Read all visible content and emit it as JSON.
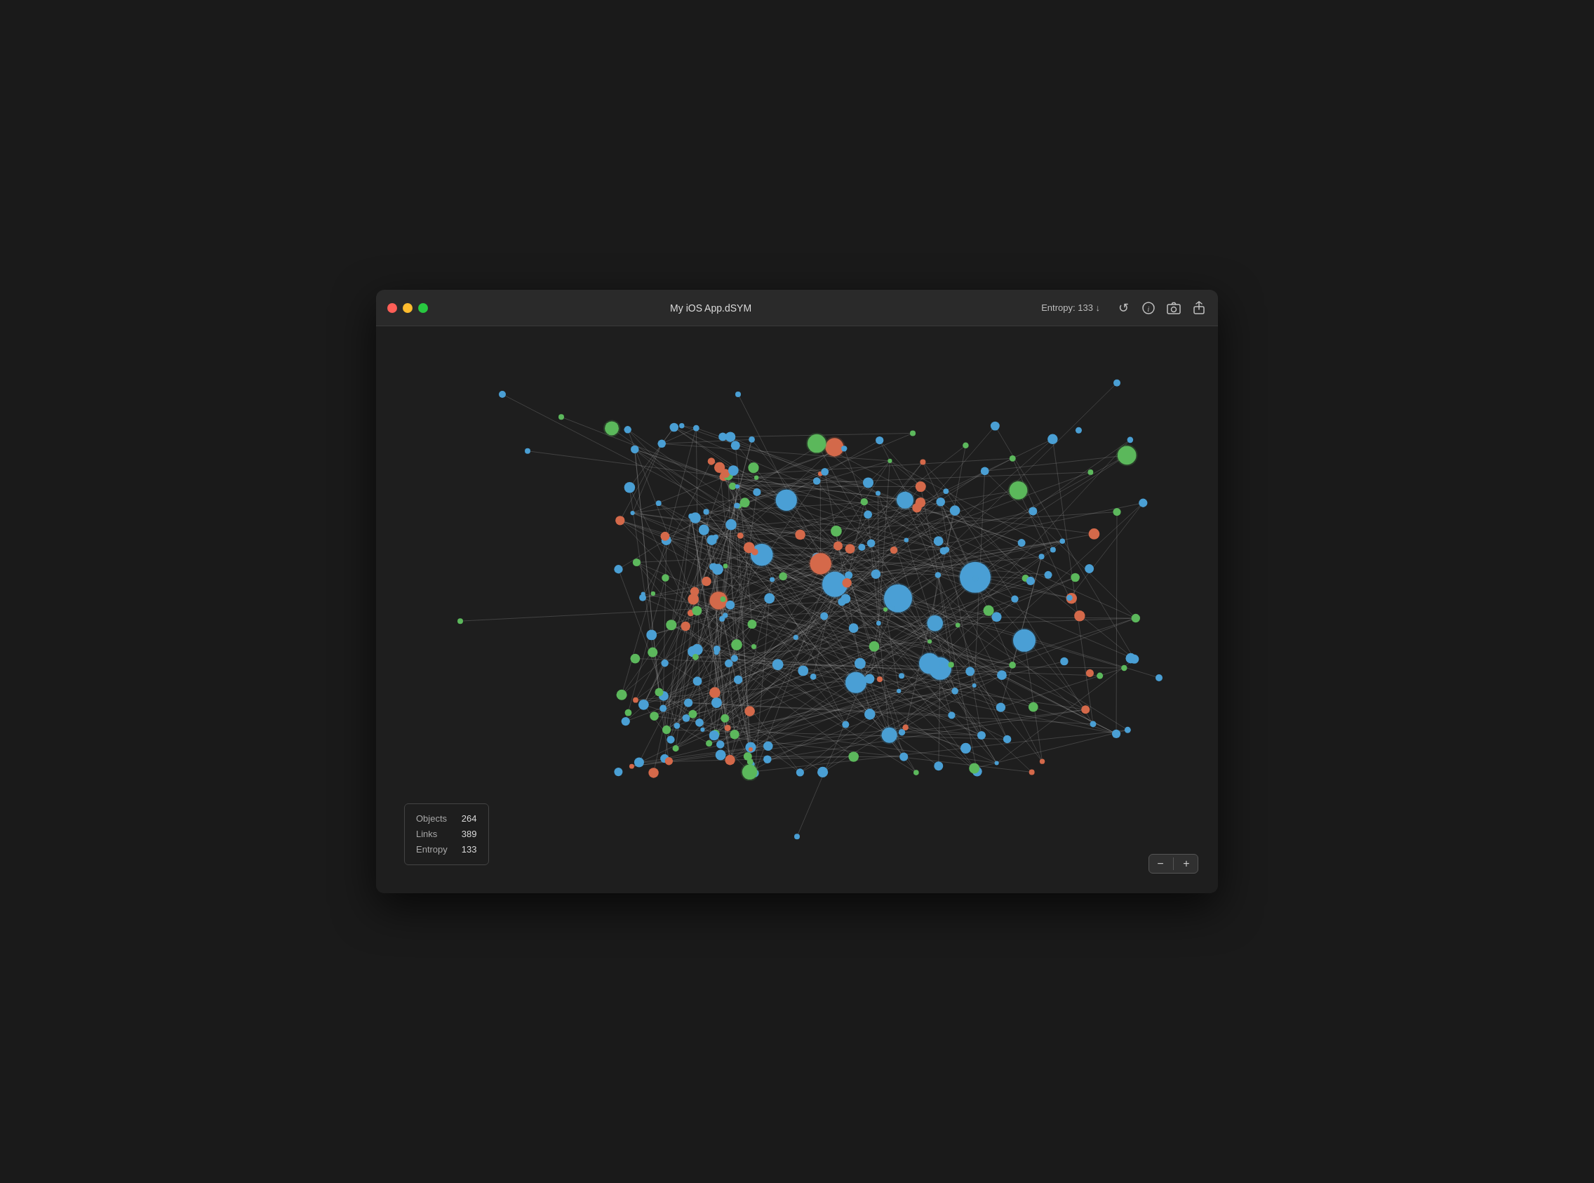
{
  "window": {
    "title": "My iOS App.dSYM",
    "entropy_label": "Entropy: 133 ↓"
  },
  "titlebar": {
    "traffic_lights": [
      {
        "id": "close",
        "label": "Close"
      },
      {
        "id": "minimize",
        "label": "Minimize"
      },
      {
        "id": "maximize",
        "label": "Maximize"
      }
    ],
    "icons": [
      {
        "name": "refresh-icon",
        "symbol": "↺"
      },
      {
        "name": "info-icon",
        "symbol": "ⓘ"
      },
      {
        "name": "camera-icon",
        "symbol": "⊡"
      },
      {
        "name": "export-icon",
        "symbol": "⬆"
      }
    ]
  },
  "stats": {
    "objects_label": "Objects",
    "objects_value": "264",
    "links_label": "Links",
    "links_value": "389",
    "entropy_label": "Entropy",
    "entropy_value": "133"
  },
  "zoom": {
    "minus_label": "−",
    "plus_label": "+"
  },
  "graph": {
    "colors": {
      "blue": "#4a9fd4",
      "green": "#5cb85c",
      "orange": "#d4694a",
      "link": "rgba(180,180,180,0.35)"
    }
  }
}
